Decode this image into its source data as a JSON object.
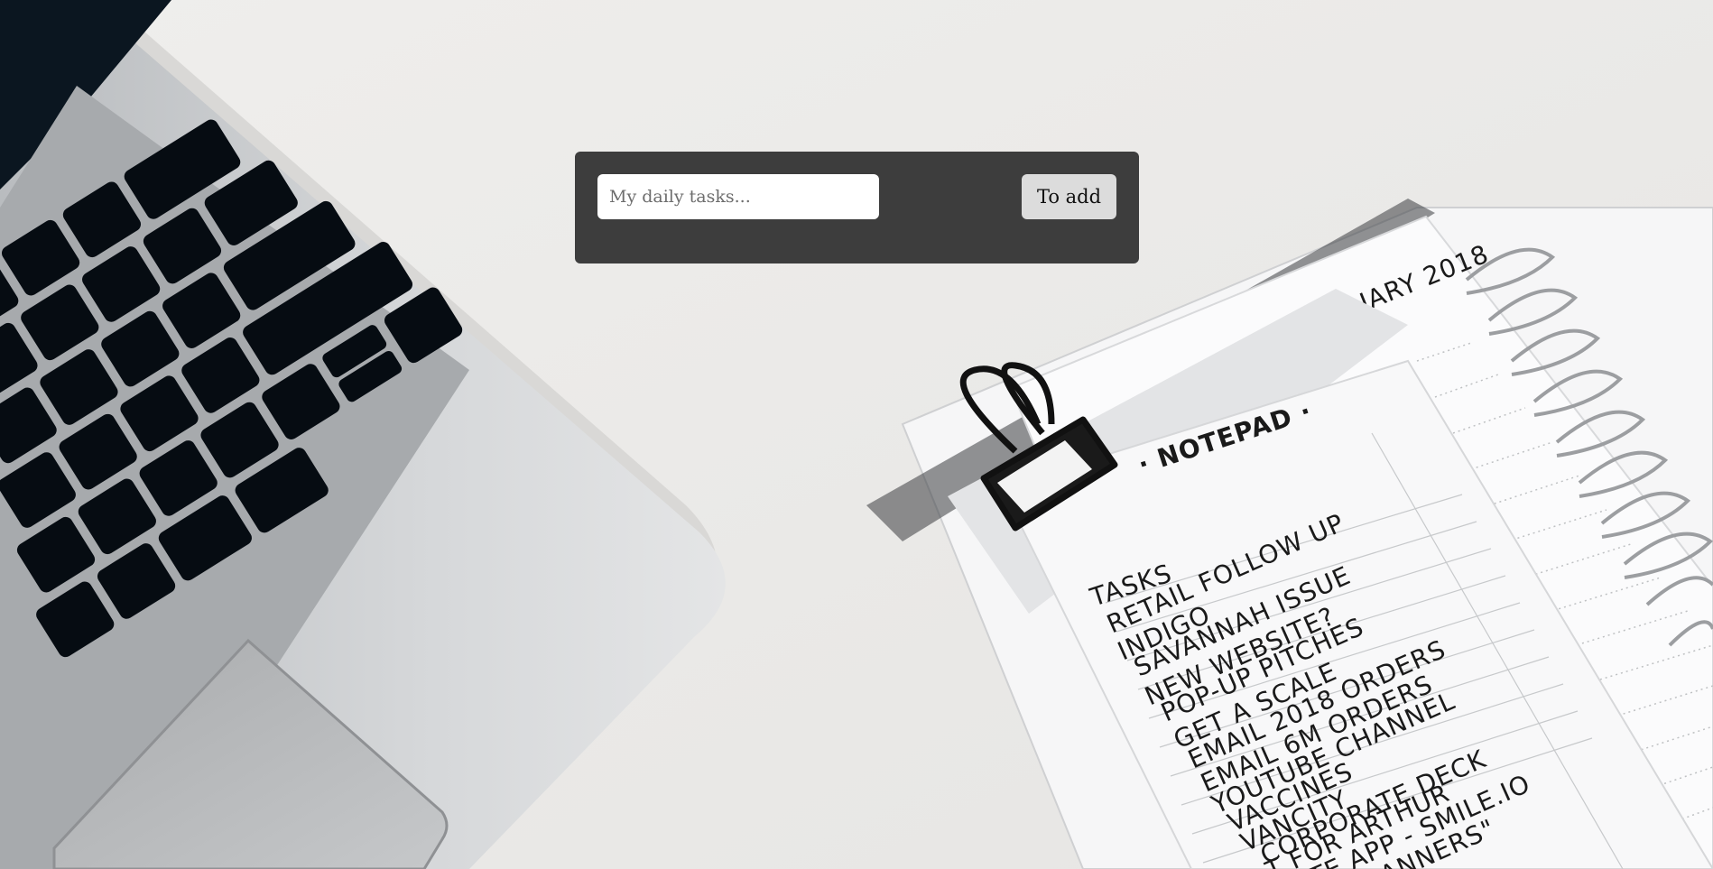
{
  "task_form": {
    "input_placeholder": "My daily tasks...",
    "input_value": "",
    "add_label": "To add"
  },
  "background": {
    "notepad_header": "· NOTEPAD ·",
    "notepad_section": "TASKS",
    "calendar_month": "UARY 2018",
    "notepad_tasks": [
      "RETAIL FOLLOW UP",
      "INDIGO",
      "SAVANNAH ISSUE",
      "NEW WEBSITE?",
      "POP-UP PITCHES",
      "GET A SCALE",
      "EMAIL 2018 ORDERS",
      "EMAIL 6M ORDERS",
      "YOUTUBE CHANNEL",
      "VACCINES",
      "VANCITY",
      "CORPORATE DECK",
      "T FOR ARTHUR",
      "ATE APP - SMILE.IO",
      "\"PLANNERS\""
    ]
  }
}
